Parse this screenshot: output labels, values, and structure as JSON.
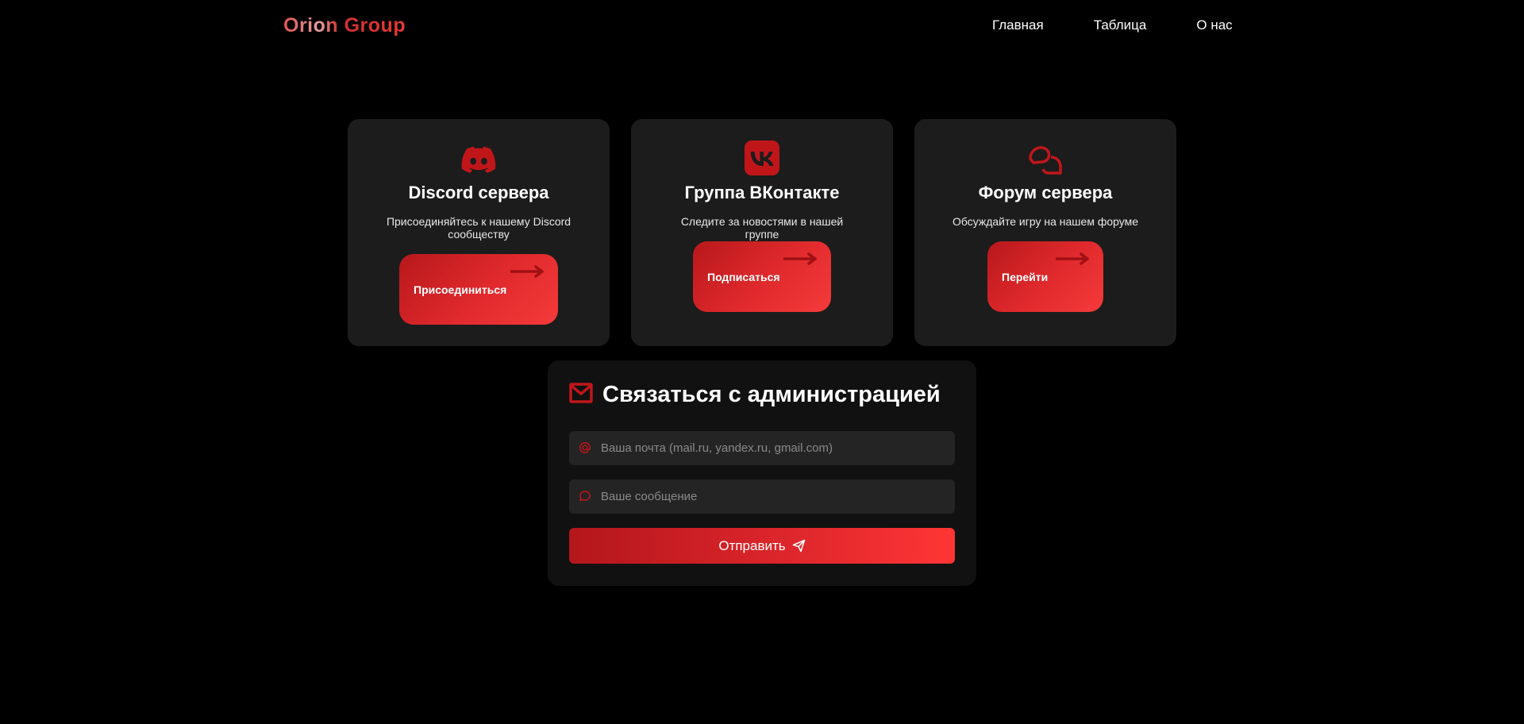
{
  "header": {
    "logo": "Orion Group",
    "nav": [
      "Главная",
      "Таблица",
      "О нас"
    ]
  },
  "cards": [
    {
      "icon": "discord-icon",
      "title": "Discord сервера",
      "description": "Присоединяйтесь к нашему Discord сообществу",
      "button": "Присоединиться"
    },
    {
      "icon": "vk-icon",
      "title": "Группа ВКонтакте",
      "description": "Следите за новостями в нашей группе",
      "button": "Подписаться"
    },
    {
      "icon": "forum-chat-icon",
      "title": "Форум сервера",
      "description": "Обсуждайте игру на нашем форуме",
      "button": "Перейти"
    }
  ],
  "contact": {
    "title": "Связаться с администрацией",
    "email_placeholder": "Ваша почта (mail.ru, yandex.ru, gmail.com)",
    "message_placeholder": "Ваше сообщение",
    "submit_label": "Отправить"
  },
  "colors": {
    "accent": "#e12a2d",
    "accent_dark": "#b3171b",
    "card_bg": "#1c1c1c",
    "background": "#000000"
  }
}
